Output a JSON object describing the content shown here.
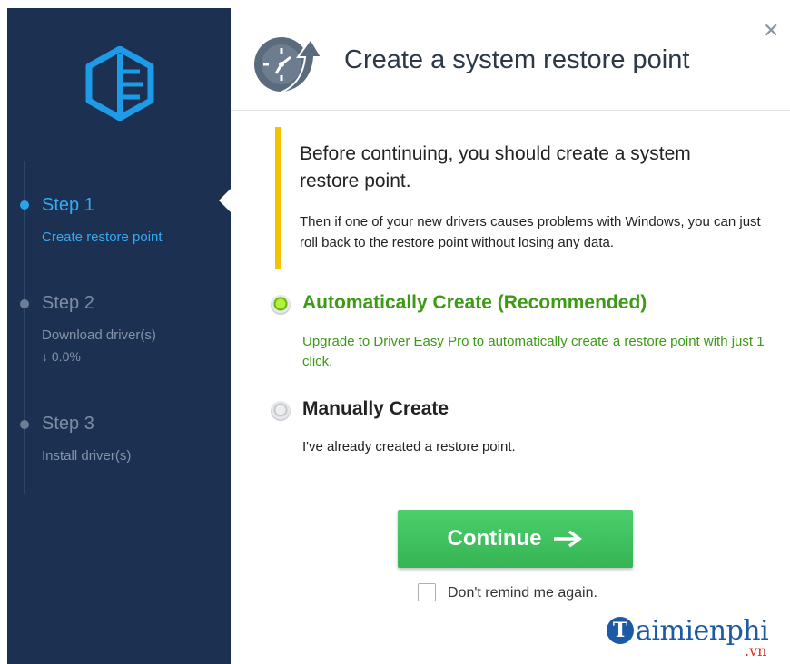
{
  "dialog": {
    "title": "Create a system restore point",
    "close_icon": "close-icon"
  },
  "sidebar": {
    "steps": [
      {
        "title": "Step 1",
        "subtitle": "Create restore point",
        "active": true
      },
      {
        "title": "Step 2",
        "subtitle": "Download driver(s)",
        "progress": "↓ 0.0%",
        "active": false
      },
      {
        "title": "Step 3",
        "subtitle": "Install driver(s)",
        "active": false
      }
    ]
  },
  "notice": {
    "heading": "Before continuing, you should create a system restore point.",
    "body": "Then if one of your new drivers causes problems with Windows, you can just roll back to the restore point without losing any data."
  },
  "options": [
    {
      "label": "Automatically Create (Recommended)",
      "description": "Upgrade to Driver Easy Pro to automatically create a restore point with just 1 click.",
      "selected": true
    },
    {
      "label": "Manually Create",
      "description": "I've already created a restore point.",
      "selected": false
    }
  ],
  "actions": {
    "continue_label": "Continue",
    "remind_label": "Don't remind me again.",
    "remind_checked": false
  },
  "watermark": {
    "initial": "T",
    "name": "aimienphi",
    "domain": ".vn"
  },
  "colors": {
    "sidebar_bg": "#1c3051",
    "active_step": "#34aaf0",
    "accent_green": "#3c9a15",
    "button_green": "#3fc05f",
    "notice_bar": "#f5c400"
  }
}
